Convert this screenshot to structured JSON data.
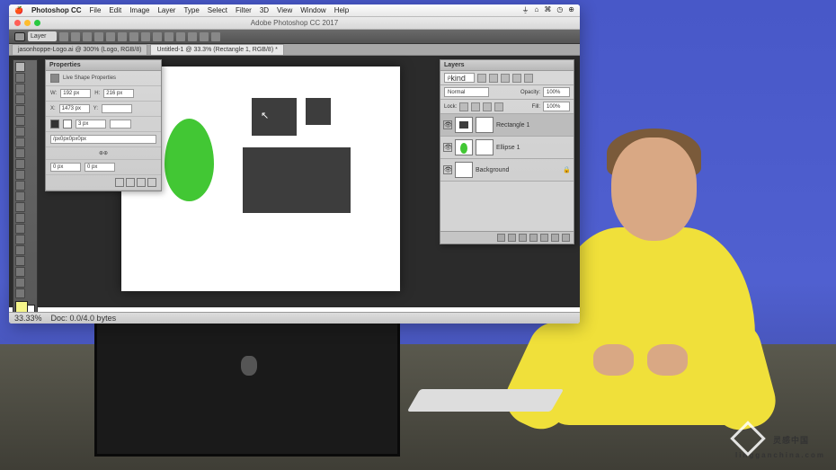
{
  "menubar": {
    "app": "Photoshop CC",
    "items": [
      "File",
      "Edit",
      "Image",
      "Layer",
      "Type",
      "Select",
      "Filter",
      "3D",
      "View",
      "Window",
      "Help"
    ]
  },
  "titlebar": {
    "title": "Adobe Photoshop CC 2017"
  },
  "optionbar": {
    "layer_label": "Layer"
  },
  "tabs": {
    "t1": "jasonhoppe-Logo.ai @ 300% (Logo, RGB/8)",
    "t2": "Untitled-1 @ 33.3% (Rectangle 1, RGB/8) *"
  },
  "properties": {
    "title": "Properties",
    "subtitle": "Live Shape Properties",
    "w_label": "W:",
    "w_val": "192 px",
    "h_label": "H:",
    "h_val": "216 px",
    "x_label": "X:",
    "x_val": "1473 px",
    "y_label": "Y:",
    "y_val": "",
    "stroke": "3 px",
    "path": "/px0px0px0px",
    "corner_a": "0 px",
    "corner_b": "0 px"
  },
  "layers": {
    "title": "Layers",
    "kind": "kind",
    "blend": "Normal",
    "opacity_label": "Opacity:",
    "opacity": "100%",
    "lock_label": "Lock:",
    "fill_label": "Fill:",
    "fill": "100%",
    "items": [
      {
        "name": "Rectangle 1"
      },
      {
        "name": "Ellipse 1"
      },
      {
        "name": "Background"
      }
    ]
  },
  "status": {
    "zoom": "33.33%",
    "doc": "Doc: 0.0/4.0 bytes"
  },
  "watermark": {
    "main": "灵感中国",
    "sub": "lingganchina.com"
  }
}
